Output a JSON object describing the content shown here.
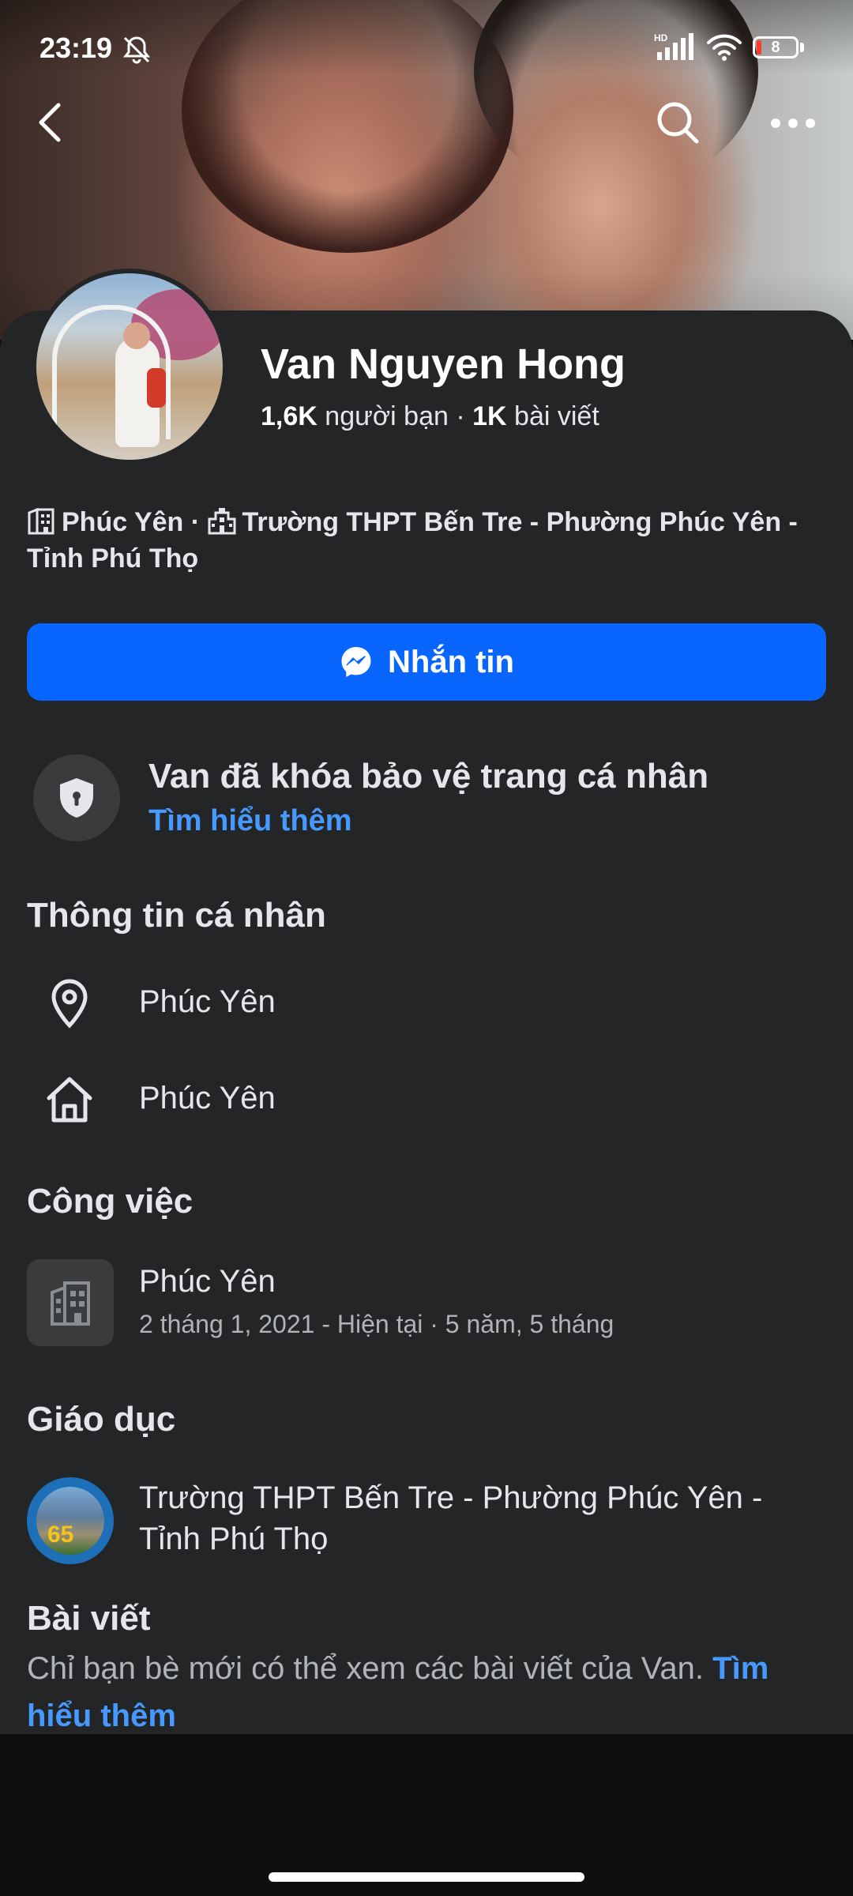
{
  "status_bar": {
    "time": "23:19",
    "network_label": "HD",
    "battery_level": "8"
  },
  "profile": {
    "name": "Van Nguyen Hong",
    "friends_count": "1,6K",
    "friends_label": "người bạn",
    "separator": " · ",
    "posts_count": "1K",
    "posts_label": "bài viết",
    "meta_location": "Phúc Yên",
    "meta_separator": " · ",
    "meta_school": "Trường THPT Bến Tre - Phường Phúc Yên - Tỉnh Phú Thọ"
  },
  "message_button": {
    "label": "Nhắn tin"
  },
  "lock_notice": {
    "title": "Van đã khóa bảo vệ trang cá nhân",
    "link": "Tìm hiểu thêm"
  },
  "personal_info": {
    "title": "Thông tin cá nhân",
    "current_city": "Phúc Yên",
    "hometown": "Phúc Yên"
  },
  "work": {
    "title": "Công việc",
    "place": "Phúc Yên",
    "period": "2 tháng 1, 2021 - Hiện tại · 5 năm, 5 tháng"
  },
  "education": {
    "title": "Giáo dục",
    "school": "Trường THPT Bến Tre - Phường Phúc Yên - Tỉnh Phú Thọ",
    "logo_text": "65"
  },
  "posts": {
    "title": "Bài viết",
    "text": "Chỉ bạn bè mới có thể xem các bài viết của Van. ",
    "link": "Tìm hiểu thêm"
  },
  "icons": {
    "back": "chevron-left-icon",
    "search": "search-icon",
    "more": "more-icon",
    "messenger": "messenger-icon",
    "shield": "shield-lock-icon",
    "location": "location-pin-icon",
    "home": "home-icon",
    "work": "building-icon"
  },
  "colors": {
    "card_bg": "#242527",
    "accent_blue": "#0866ff",
    "link_blue": "#4599ff",
    "text_primary": "#e4e6eb",
    "text_secondary": "#b0b3b8"
  }
}
